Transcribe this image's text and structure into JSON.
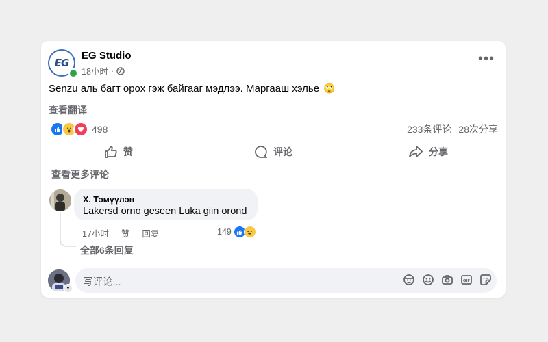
{
  "post": {
    "page_name": "EG Studio",
    "time": "18小时",
    "separator": "·",
    "avatar_logo": "EG",
    "text": "Senzu аль багт орох гэж байгааг мэдлээ. Маргааш хэлье",
    "text_emoji": "🙄",
    "translate_label": "查看翻译",
    "reaction_count": "498",
    "comments_count": "233条评论",
    "shares_count": "28次分享",
    "more_icon": "•••"
  },
  "actions": {
    "like": "赞",
    "comment": "评论",
    "share": "分享"
  },
  "comments": {
    "more_label": "查看更多评论",
    "item": {
      "author": "Х. Тэмүүлэн",
      "text": "Lakersd orno geseen Luka giin orond",
      "time": "17小时",
      "like": "赞",
      "reply": "回复",
      "reaction_count": "149"
    },
    "replies_label": "全部6条回复"
  },
  "composer": {
    "placeholder": "写评论...",
    "icons": [
      "avatar-sticker-icon",
      "emoji-icon",
      "camera-icon",
      "gif-icon",
      "sticker-icon"
    ]
  },
  "colors": {
    "accent": "#1877f2",
    "muted": "#65676b",
    "online": "#31a24c",
    "bubble": "#f0f2f5"
  }
}
